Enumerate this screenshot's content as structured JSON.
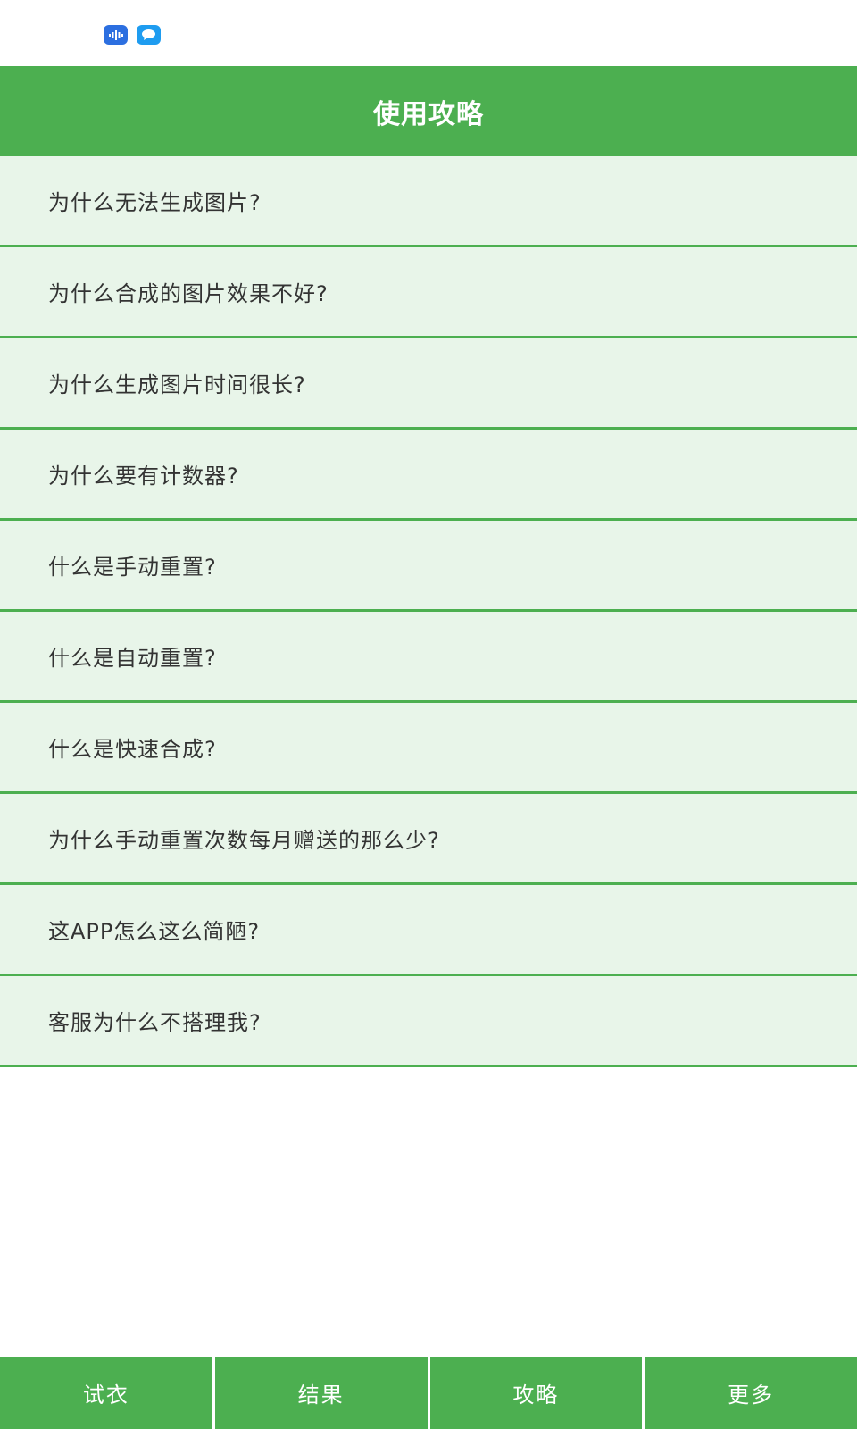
{
  "status_bar": {
    "icons": [
      "voice-icon",
      "chat-bubble-icon"
    ]
  },
  "header": {
    "title": "使用攻略"
  },
  "faq": {
    "items": [
      "为什么无法生成图片?",
      "为什么合成的图片效果不好?",
      "为什么生成图片时间很长?",
      "为什么要有计数器?",
      "什么是手动重置?",
      "什么是自动重置?",
      "什么是快速合成?",
      "为什么手动重置次数每月赠送的那么少?",
      "这APP怎么这么简陋?",
      "客服为什么不搭理我?"
    ]
  },
  "bottom_nav": {
    "tabs": [
      "试衣",
      "结果",
      "攻略",
      "更多"
    ]
  },
  "colors": {
    "accent": "#4caf50",
    "item_background": "#e8f5e9",
    "text": "#333333"
  }
}
